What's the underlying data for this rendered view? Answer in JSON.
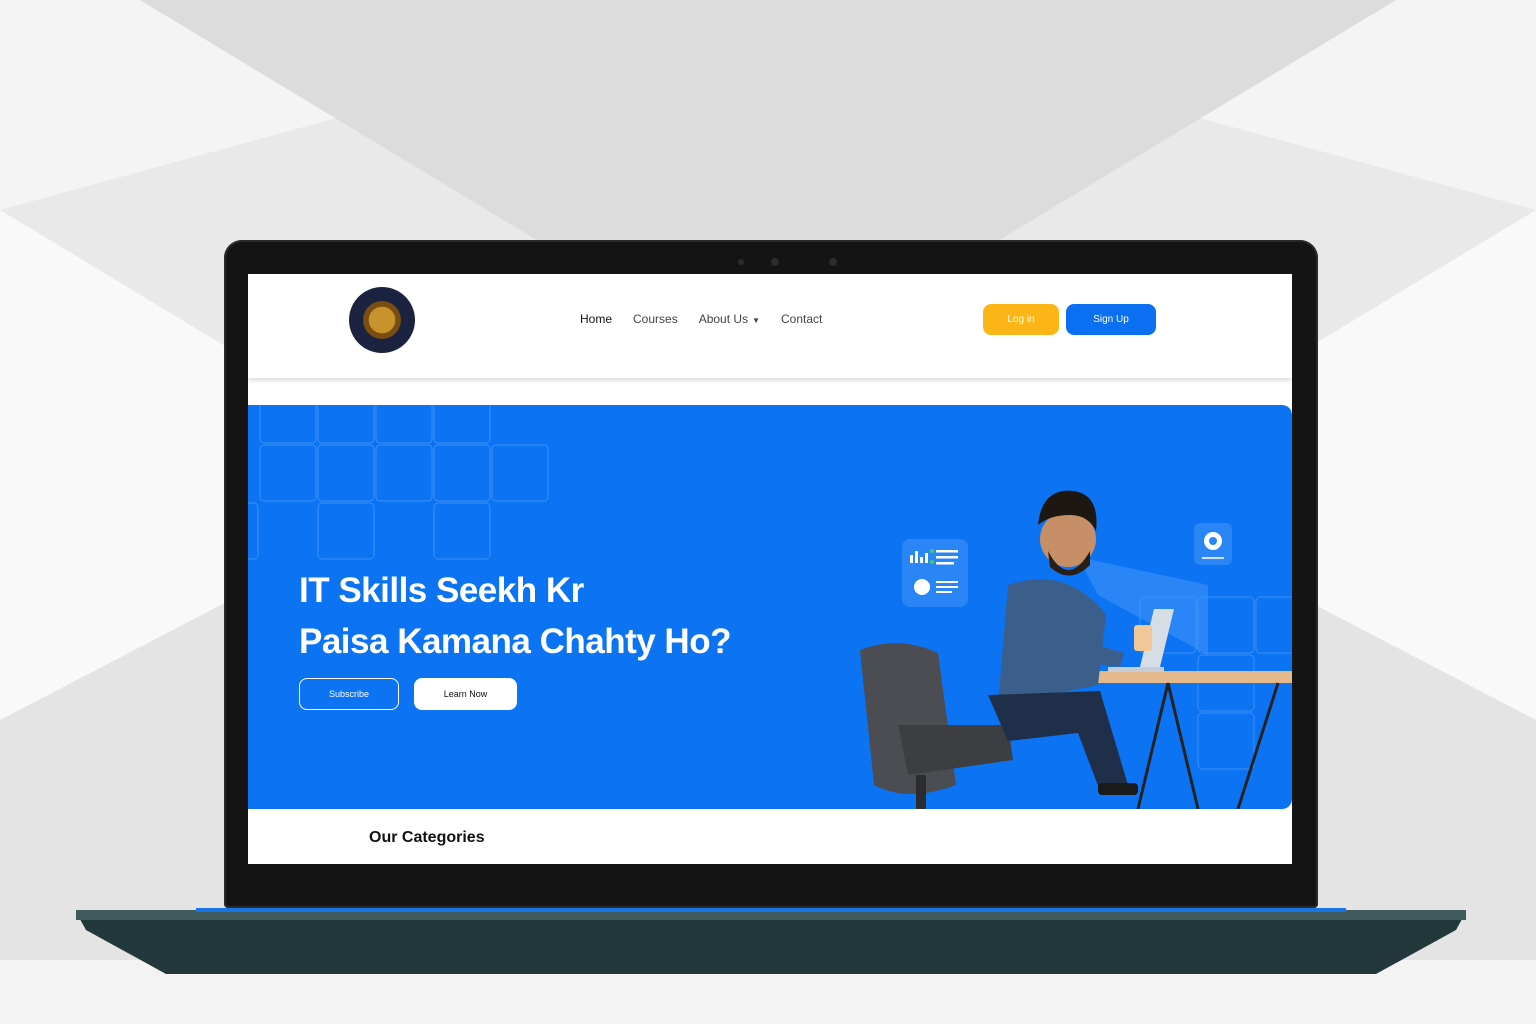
{
  "nav": {
    "items": [
      {
        "label": "Home",
        "active": true
      },
      {
        "label": "Courses",
        "active": false
      },
      {
        "label": "About Us",
        "active": false,
        "has_dropdown": true
      },
      {
        "label": "Contact",
        "active": false
      }
    ]
  },
  "header": {
    "login_label": "Log in",
    "signup_label": "Sign Up",
    "logo_icon": "crest-logo-icon"
  },
  "hero": {
    "title_line1": "IT Skills Seekh Kr",
    "title_line2": "Paisa Kamana Chahty Ho?",
    "subscribe_label": "Subscribe",
    "learn_label": "Learn Now",
    "illustration": "man-with-laptop-illustration"
  },
  "sections": {
    "categories_title": "Our Categories"
  },
  "colors": {
    "primary": "#0c74f2",
    "login": "#fbb517",
    "signup": "#0a6ff0"
  }
}
